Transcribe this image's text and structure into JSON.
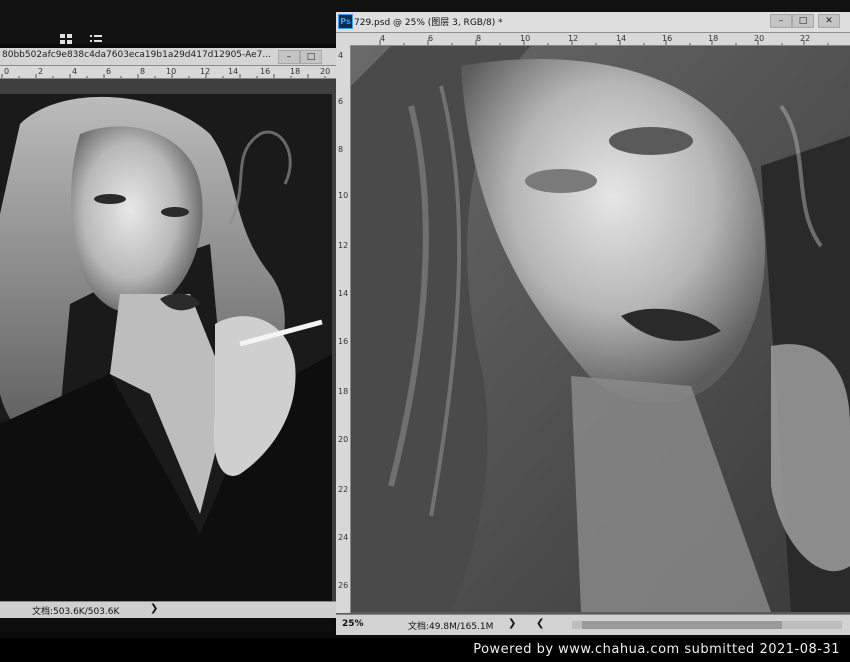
{
  "left_window": {
    "title": "80bb502afc9e838c4da7603eca19b1a29d417d12905-Ae7...",
    "ruler_labels": [
      "0",
      "2",
      "4",
      "6",
      "8",
      "10",
      "12",
      "14",
      "16",
      "18",
      "20"
    ],
    "status_docinfo": "文档:503.6K/503.6K",
    "nav_arrow": "❯"
  },
  "right_window": {
    "badge": "Ps",
    "title": "729.psd @ 25% (图层 3, RGB/8) *",
    "ruler_labels": [
      "4",
      "6",
      "8",
      "10",
      "12",
      "14",
      "16",
      "18",
      "20",
      "22"
    ],
    "vruler_labels": [
      "4",
      "6",
      "8",
      "10",
      "12",
      "14",
      "16",
      "18",
      "20",
      "22",
      "24",
      "26"
    ],
    "zoom": "25%",
    "status_docinfo": "文档:49.8M/165.1M",
    "nav_arrow_right": "❯",
    "nav_arrow_left": "❮"
  },
  "window_buttons": {
    "minimize": "–",
    "maximize": "□",
    "close": "✕"
  },
  "watermark": "Powered  by  www.chahua.com  submitted  2021-08-31"
}
